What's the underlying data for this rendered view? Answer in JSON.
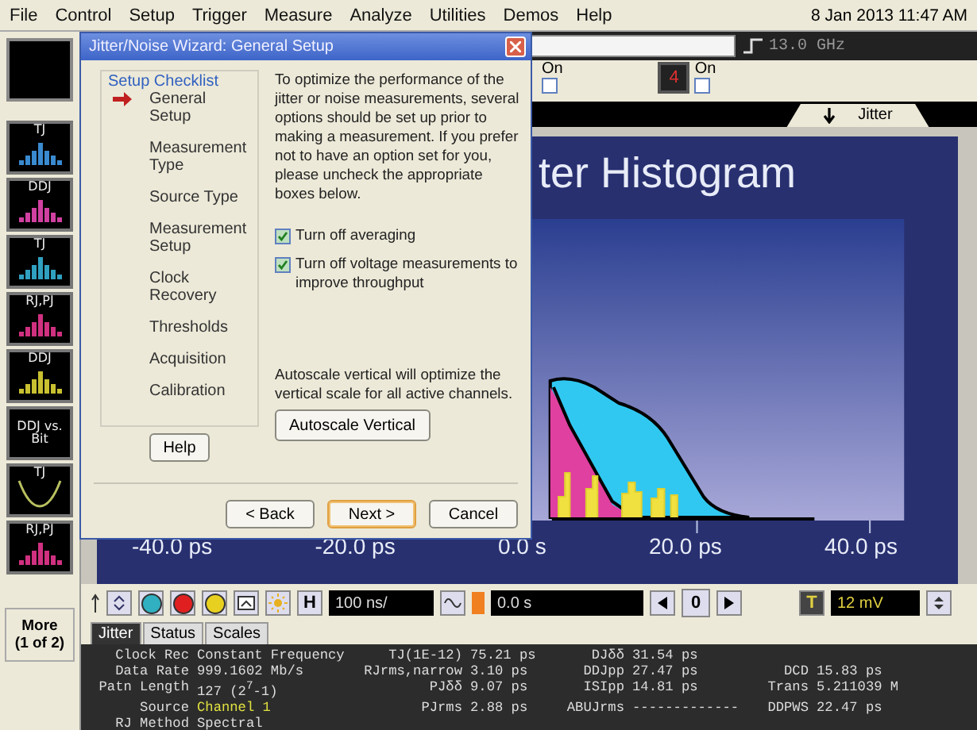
{
  "menu_bar": {
    "items": [
      "File",
      "Control",
      "Setup",
      "Trigger",
      "Measure",
      "Analyze",
      "Utilities",
      "Demos",
      "Help"
    ],
    "datetime": "8 Jan 2013 11:47 AM"
  },
  "sidebar": {
    "thumbnails": [
      {
        "label": "TJ",
        "kind": "histogram",
        "color": "#3a8ad0"
      },
      {
        "label": "DDJ",
        "kind": "histogram",
        "color": "#d040a0"
      },
      {
        "label": "TJ",
        "kind": "histogram",
        "color": "#30a0c0"
      },
      {
        "label": "RJ,PJ",
        "kind": "histogram",
        "color": "#d03080"
      },
      {
        "label": "DDJ",
        "kind": "histogram",
        "color": "#c8c030"
      },
      {
        "label": "DDJ vs. Bit",
        "kind": "text"
      },
      {
        "label": "TJ",
        "kind": "bathtub",
        "color": "#b8c060"
      },
      {
        "label": "RJ,PJ",
        "kind": "histogram",
        "color": "#d03080"
      }
    ],
    "more_button": [
      "More",
      "(1 of 2)"
    ]
  },
  "controls": {
    "bandwidth": "13.0 GHz",
    "channels": [
      {
        "label": "On",
        "checked": false
      },
      {
        "number": "4",
        "label": "On",
        "checked": false
      }
    ]
  },
  "plot_tabs": [
    {
      "label": "Jitter",
      "selected": true
    }
  ],
  "plot": {
    "title": "ter Histogram",
    "x_labels": [
      "-40.0 ps",
      "-20.0 ps",
      "0.0 s",
      "20.0 ps",
      "40.0 ps"
    ]
  },
  "toolbar": {
    "channel_buttons": [
      {
        "color": "#30b0c0"
      },
      {
        "color": "#e02020"
      },
      {
        "color": "#e8d020"
      }
    ],
    "horizontal_key": "H",
    "timebase": "100 ns/",
    "position": "0.0 s",
    "segment": "0",
    "trigger_key": "T",
    "trigger_level": "12 mV"
  },
  "bottom_tabs": [
    {
      "label": "Jitter",
      "selected": true
    },
    {
      "label": "Status",
      "selected": false
    },
    {
      "label": "Scales",
      "selected": false
    }
  ],
  "measurements": {
    "rows": [
      [
        {
          "label": "Clock Rec",
          "value": "Constant Frequency",
          "kind": "plain"
        },
        {
          "label": "TJ(1E-12)",
          "value": "75.21 ps",
          "kind": "plain"
        },
        {
          "label": "DJδδ",
          "value": "31.54 ps",
          "kind": "plain"
        }
      ],
      [
        {
          "label": "Data Rate",
          "value": "999.1602 Mb/s",
          "kind": "plain"
        },
        {
          "label": "RJrms,narrow",
          "value": "3.10 ps",
          "kind": "plain"
        },
        {
          "label": "DDJpp",
          "value": "27.47 ps",
          "kind": "plain"
        },
        {
          "label": "DCD",
          "value": "15.83 ps",
          "kind": "plain"
        }
      ],
      [
        {
          "label": "Patn Length",
          "value": "127 (2$^{7}$-1)",
          "kind": "plain"
        },
        {
          "label": "PJδδ",
          "value": "9.07 ps",
          "kind": "plain"
        },
        {
          "label": "ISIpp",
          "value": "14.81 ps",
          "kind": "plain"
        },
        {
          "label": "Trans",
          "value": "5.211039 M",
          "kind": "plain"
        }
      ],
      [
        {
          "label": "Source",
          "value": "Channel 1",
          "kind": "source"
        },
        {
          "label": "PJrms",
          "value": "2.88 ps",
          "kind": "plain"
        },
        {
          "label": "ABUJrms",
          "value": "-------------",
          "kind": "plain"
        },
        {
          "label": "DDPWS",
          "value": "22.47 ps",
          "kind": "plain"
        }
      ],
      [
        {
          "label": "RJ Method",
          "value": "Spectral",
          "kind": "plain"
        }
      ]
    ]
  },
  "dialog": {
    "title": "Jitter/Noise Wizard: General Setup",
    "checklist_title": "Setup Checklist",
    "steps": [
      {
        "label": "General Setup",
        "selected": true
      },
      {
        "label": "Measurement Type",
        "selected": false
      },
      {
        "label": "Source Type",
        "selected": false
      },
      {
        "label": "Measurement Setup",
        "selected": false
      },
      {
        "label": "Clock Recovery",
        "selected": false
      },
      {
        "label": "Thresholds",
        "selected": false
      },
      {
        "label": "Acquisition",
        "selected": false
      },
      {
        "label": "Calibration",
        "selected": false
      }
    ],
    "help_button": "Help",
    "description": "To optimize the performance of the jitter or noise measurements, several options should be set up prior to making a measurement. If you prefer not to have an option set for you, please uncheck the appropriate boxes below.",
    "options": [
      {
        "label": "Turn off averaging",
        "checked": true
      },
      {
        "label": "Turn off voltage measurements to improve throughput",
        "checked": true
      }
    ],
    "autoscale_note": "Autoscale vertical will optimize the vertical scale for all active channels.",
    "autoscale_button": "Autoscale Vertical",
    "buttons": [
      {
        "label": "< Back",
        "default": false
      },
      {
        "label": "Next >",
        "default": true
      },
      {
        "label": "Cancel",
        "default": false
      }
    ]
  }
}
